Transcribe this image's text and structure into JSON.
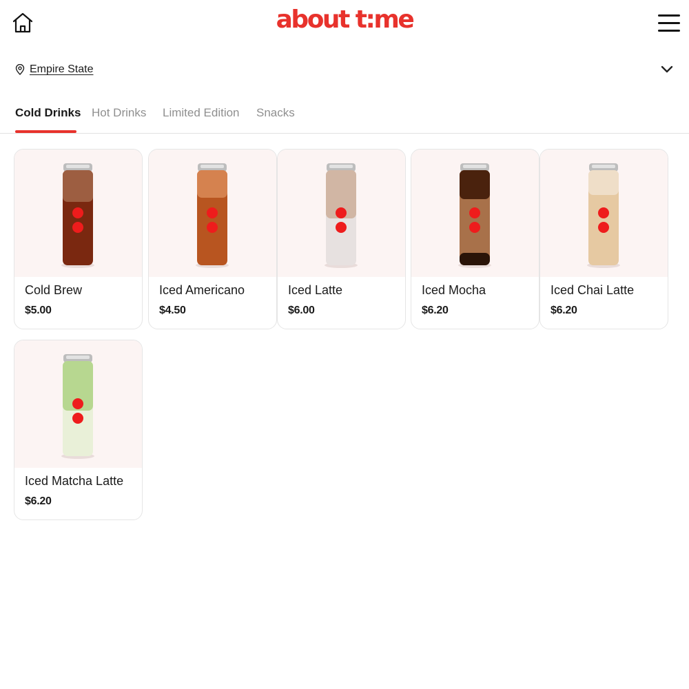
{
  "header": {
    "logo": "about t:me"
  },
  "location": {
    "name": "Empire State"
  },
  "tabs": [
    {
      "label": "Cold Drinks",
      "active": true
    },
    {
      "label": "Hot Drinks",
      "active": false
    },
    {
      "label": "Limited Edition",
      "active": false
    },
    {
      "label": "Snacks",
      "active": false
    }
  ],
  "products": [
    {
      "name": "Cold Brew",
      "price": "$5.00"
    },
    {
      "name": "Iced Americano",
      "price": "$4.50"
    },
    {
      "name": "Iced Latte",
      "price": "$6.00"
    },
    {
      "name": "Iced Mocha",
      "price": "$6.20"
    },
    {
      "name": "Iced Chai Latte",
      "price": "$6.20"
    },
    {
      "name": "Iced Matcha Latte",
      "price": "$6.20"
    }
  ],
  "colors": {
    "brand": "#e8322c",
    "tab_active": "#1a1a1a",
    "tab_inactive": "#8f8f8f"
  },
  "icons": [
    "home-icon",
    "hamburger-menu-icon",
    "location-pin-icon",
    "chevron-down-icon"
  ]
}
